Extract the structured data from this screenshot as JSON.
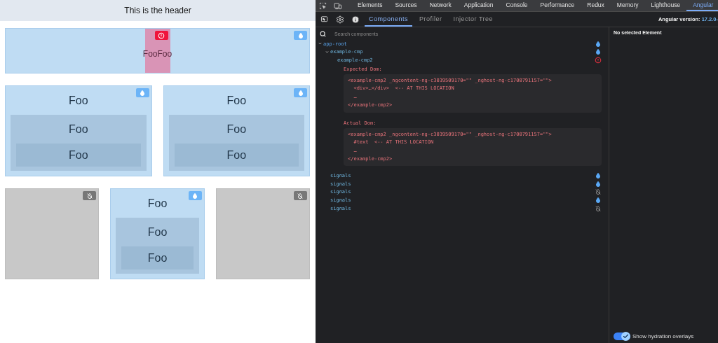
{
  "app": {
    "header": "This is the header",
    "rows": [
      {
        "cards": [
          {
            "kind": "hydrated",
            "children": [
              {
                "kind": "mismatch",
                "text": "FooFoo"
              }
            ]
          }
        ]
      },
      {
        "cards": [
          {
            "kind": "hydrated",
            "text": "Foo",
            "children": [
              {
                "text": "Foo",
                "children": [
                  {
                    "text": "Foo"
                  }
                ]
              }
            ]
          },
          {
            "kind": "hydrated",
            "text": "Foo",
            "children": [
              {
                "text": "Foo",
                "children": [
                  {
                    "text": "Foo"
                  }
                ]
              }
            ]
          }
        ]
      },
      {
        "cards": [
          {
            "kind": "skipped"
          },
          {
            "kind": "hydrated",
            "text": "Foo",
            "children": [
              {
                "text": "Foo",
                "children": [
                  {
                    "text": "Foo"
                  }
                ]
              }
            ]
          },
          {
            "kind": "skipped"
          }
        ]
      }
    ]
  },
  "devtools": {
    "toolbar_tabs": [
      {
        "label": "Elements",
        "selected": false
      },
      {
        "label": "Sources",
        "selected": false
      },
      {
        "label": "Network",
        "selected": false
      },
      {
        "label": "Application",
        "selected": false
      },
      {
        "label": "Console",
        "selected": false
      },
      {
        "label": "Performance",
        "selected": false
      },
      {
        "label": "Redux",
        "selected": false
      },
      {
        "label": "Memory",
        "selected": false
      },
      {
        "label": "Lighthouse",
        "selected": false
      },
      {
        "label": "Angular",
        "selected": true
      }
    ],
    "panel_tabs": [
      {
        "label": "Components",
        "selected": true
      },
      {
        "label": "Profiler",
        "selected": false
      },
      {
        "label": "Injector Tree",
        "selected": false
      }
    ],
    "version": {
      "label": "Angular version:",
      "value": "17.2.0-"
    },
    "search": {
      "placeholder": "Search components"
    },
    "tree": [
      {
        "name": "app-root",
        "kind": "hydrated",
        "expanded": true,
        "children": [
          {
            "name": "example-cmp",
            "kind": "hydrated",
            "expanded": true,
            "children": [
              {
                "name": "example-cmp2",
                "kind": "mismatch",
                "error": [
                  {
                    "label": "Expected Dom:",
                    "lines": [
                      "<example-cmp2 _ngcontent-ng-c3039509170=\"\" _nghost-ng-c1700791157=\"\">",
                      "  <div>…</div>  <-- AT THIS LOCATION",
                      "  …",
                      "</example-cmp2>"
                    ]
                  },
                  {
                    "label": "Actual Dom:",
                    "lines": [
                      "<example-cmp2 _ngcontent-ng-c3039509170=\"\" _nghost-ng-c1700791157=\"\">",
                      "  #text  <-- AT THIS LOCATION",
                      "  …",
                      "</example-cmp2>"
                    ]
                  }
                ]
              }
            ]
          },
          {
            "name": "signals",
            "kind": "hydrated"
          },
          {
            "name": "signals",
            "kind": "hydrated"
          },
          {
            "name": "signals",
            "kind": "skipped"
          },
          {
            "name": "signals",
            "kind": "hydrated"
          },
          {
            "name": "signals",
            "kind": "skipped"
          }
        ]
      }
    ],
    "details": {
      "title": "No selected Element"
    },
    "overlay_toggle": {
      "label": "Show hydration overlays",
      "checked": true
    }
  }
}
